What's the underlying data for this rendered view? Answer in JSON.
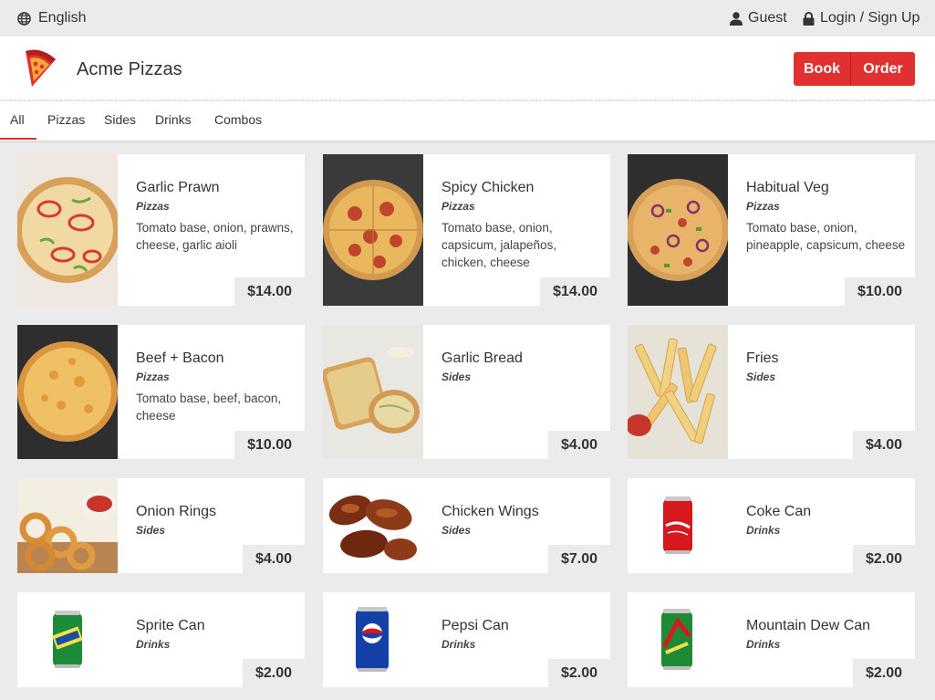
{
  "topbar": {
    "language": "English",
    "guest": "Guest",
    "login": "Login / Sign Up"
  },
  "header": {
    "title": "Acme Pizzas",
    "book_label": "Book",
    "order_label": "Order"
  },
  "tabs": [
    {
      "label": "All"
    },
    {
      "label": "Pizzas"
    },
    {
      "label": "Sides"
    },
    {
      "label": "Drinks"
    },
    {
      "label": "Combos"
    }
  ],
  "items": [
    {
      "name": "Garlic Prawn",
      "category": "Pizzas",
      "description": "Tomato base, onion, prawns, cheese, garlic aioli",
      "price": "$14.00",
      "image": "pizza-pepper"
    },
    {
      "name": "Spicy Chicken",
      "category": "Pizzas",
      "description": "Tomato base, onion, capsicum, jalapeños, chicken, cheese",
      "price": "$14.00",
      "image": "pizza-salami"
    },
    {
      "name": "Habitual Veg",
      "category": "Pizzas",
      "description": "Tomato base, onion, pineapple, capsicum, cheese",
      "price": "$10.00",
      "image": "pizza-veg"
    },
    {
      "name": "Beef + Bacon",
      "category": "Pizzas",
      "description": "Tomato base, beef, bacon, cheese",
      "price": "$10.00",
      "image": "pizza-cheese"
    },
    {
      "name": "Garlic Bread",
      "category": "Sides",
      "description": "",
      "price": "$4.00",
      "image": "garlic-bread"
    },
    {
      "name": "Fries",
      "category": "Sides",
      "description": "",
      "price": "$4.00",
      "image": "fries"
    },
    {
      "name": "Onion Rings",
      "category": "Sides",
      "description": "",
      "price": "$4.00",
      "image": "onion-rings"
    },
    {
      "name": "Chicken Wings",
      "category": "Sides",
      "description": "",
      "price": "$7.00",
      "image": "chicken-wings"
    },
    {
      "name": "Coke Can",
      "category": "Drinks",
      "description": "",
      "price": "$2.00",
      "image": "coke-can"
    },
    {
      "name": "Sprite Can",
      "category": "Drinks",
      "description": "",
      "price": "$2.00",
      "image": "sprite-can"
    },
    {
      "name": "Pepsi Can",
      "category": "Drinks",
      "description": "",
      "price": "$2.00",
      "image": "pepsi-can"
    },
    {
      "name": "Mountain Dew Can",
      "category": "Drinks",
      "description": "",
      "price": "$2.00",
      "image": "mountain-dew-can"
    }
  ],
  "colors": {
    "accent": "#e03030",
    "background": "#ebebeb",
    "card": "#ffffff"
  }
}
